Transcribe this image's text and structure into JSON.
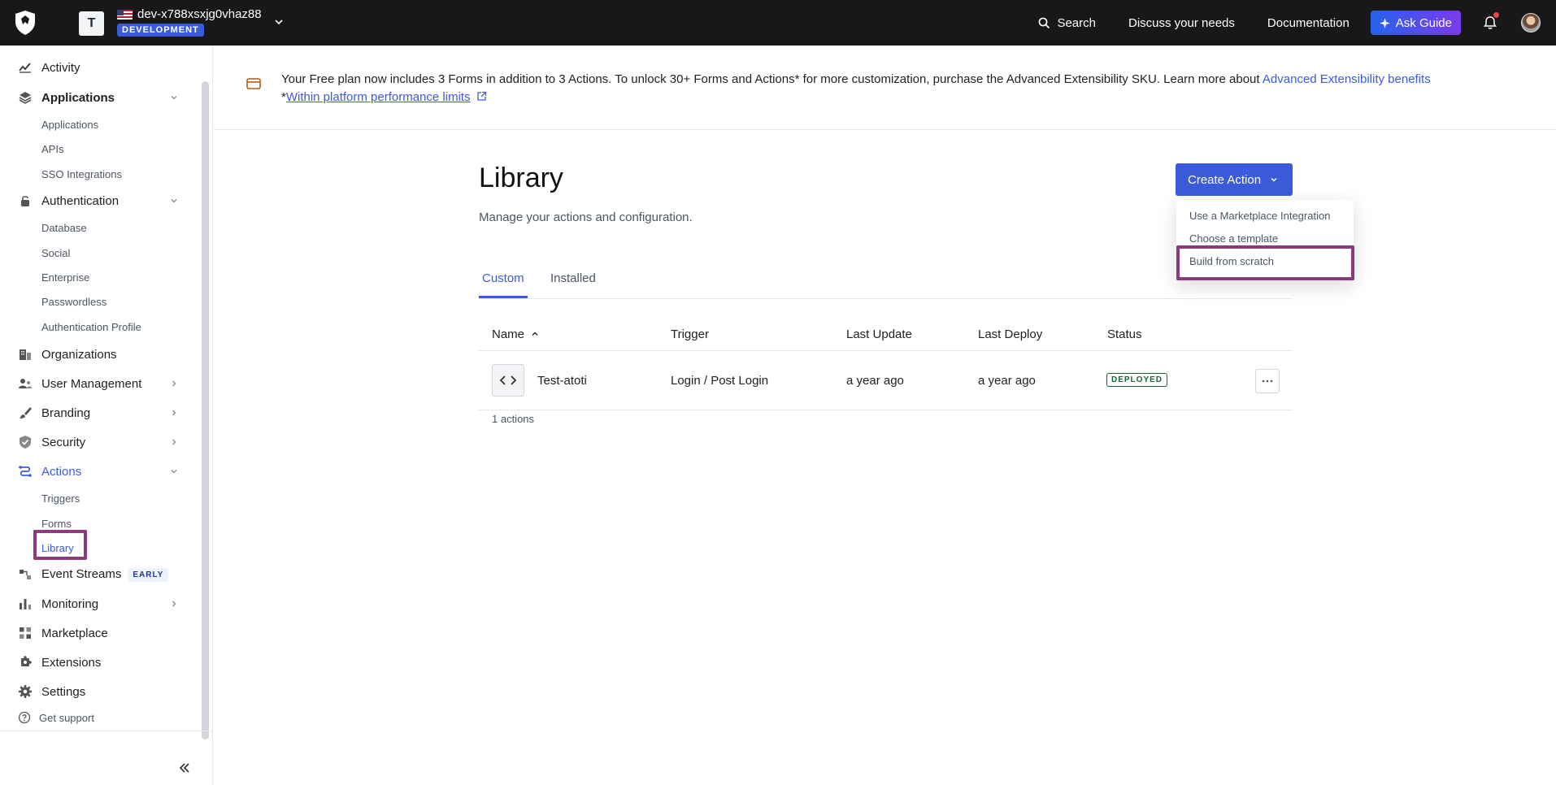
{
  "topbar": {
    "tenant_initial": "T",
    "tenant_name": "dev-x788xsxjg0vhaz88",
    "environment": "DEVELOPMENT",
    "search_label": "Search",
    "discuss_label": "Discuss your needs",
    "docs_label": "Documentation",
    "ask_guide_label": "Ask Guide"
  },
  "sidebar": {
    "items": {
      "activity": "Activity",
      "applications": "Applications",
      "applications_sub": [
        "Applications",
        "APIs",
        "SSO Integrations"
      ],
      "authentication": "Authentication",
      "authentication_sub": [
        "Database",
        "Social",
        "Enterprise",
        "Passwordless",
        "Authentication Profile"
      ],
      "organizations": "Organizations",
      "user_management": "User Management",
      "branding": "Branding",
      "security": "Security",
      "actions": "Actions",
      "actions_sub": [
        "Triggers",
        "Forms",
        "Library"
      ],
      "event_streams": "Event Streams",
      "event_streams_badge": "EARLY",
      "monitoring": "Monitoring",
      "marketplace": "Marketplace",
      "extensions": "Extensions",
      "settings": "Settings"
    },
    "get_support": "Get support"
  },
  "banner": {
    "text": "Your Free plan now includes 3 Forms in addition to 3 Actions. To unlock 30+ Forms and Actions* for more customization, purchase the Advanced Extensibility SKU. Learn more about ",
    "link": "Advanced Extensibility benefits",
    "footnote_prefix": "*",
    "footnote_link": "Within platform performance limits"
  },
  "main": {
    "title": "Library",
    "subtitle": "Manage your actions and configuration.",
    "create_button": "Create Action",
    "dropdown": [
      "Use a Marketplace Integration",
      "Choose a template",
      "Build from scratch"
    ],
    "tabs": [
      "Custom",
      "Installed"
    ],
    "columns": [
      "Name",
      "Trigger",
      "Last Update",
      "Last Deploy",
      "Status"
    ],
    "rows": [
      {
        "name": "Test-atoti",
        "trigger": "Login / Post Login",
        "last_update": "a year ago",
        "last_deploy": "a year ago",
        "status": "DEPLOYED"
      }
    ],
    "count": "1 actions"
  },
  "colors": {
    "accent": "#3b5bdb",
    "topbar": "#18181b",
    "highlight": "#8b3a7d",
    "deployed": "#166534"
  }
}
